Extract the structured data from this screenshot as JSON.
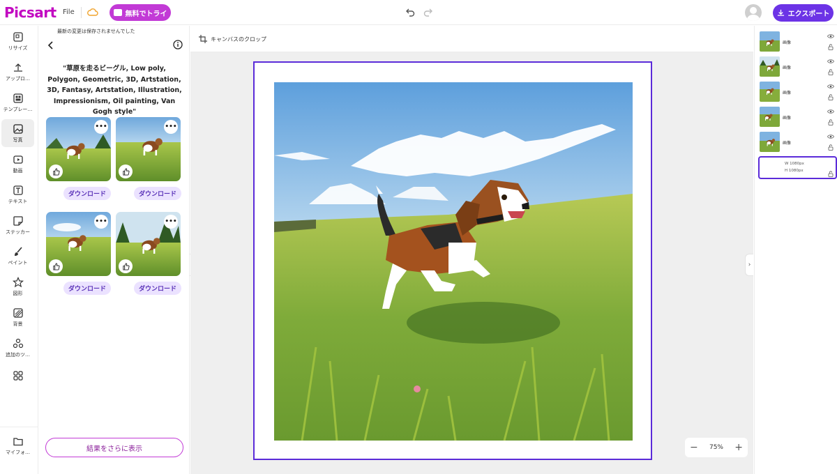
{
  "topbar": {
    "logo": "Picsart",
    "file_label": "File",
    "try_label": "無料でトライ",
    "export_label": "エクスポート"
  },
  "rail": {
    "items": [
      {
        "label": "リサイズ",
        "icon": "resize-icon"
      },
      {
        "label": "アップロ…",
        "icon": "upload-icon"
      },
      {
        "label": "テンプレー…",
        "icon": "templates-icon"
      },
      {
        "label": "写真",
        "icon": "photo-icon"
      },
      {
        "label": "動画",
        "icon": "video-icon"
      },
      {
        "label": "テキスト",
        "icon": "text-icon"
      },
      {
        "label": "ステッカー",
        "icon": "sticker-icon"
      },
      {
        "label": "ペイント",
        "icon": "paint-icon"
      },
      {
        "label": "図形",
        "icon": "shape-icon"
      },
      {
        "label": "背景",
        "icon": "background-icon"
      },
      {
        "label": "追加のツ…",
        "icon": "tools-icon"
      },
      {
        "label": "",
        "icon": "apps-icon"
      },
      {
        "label": "マイフォ…",
        "icon": "folder-icon"
      }
    ]
  },
  "panel": {
    "unsaved_notice": "最新の変更は保存されませんでした",
    "prompt": "\"草原を走るビーグル, Low poly, Polygon, Geometric, 3D, Artstation, 3D, Fantasy, Artstation, Illustration, Impressionism, Oil painting, Van Gogh style\"",
    "download_label": "ダウンロード",
    "more_results_label": "結果をさらに表示"
  },
  "canvas": {
    "crop_label": "キャンバスのクロップ",
    "zoom": "75%",
    "zoom_minus": "−",
    "zoom_plus": "+"
  },
  "layers": {
    "items": [
      {
        "name": "画像"
      },
      {
        "name": "画像"
      },
      {
        "name": "画像"
      },
      {
        "name": "画像"
      },
      {
        "name": "画像"
      }
    ],
    "background": {
      "width": "W 1080px",
      "height": "H 1080px"
    }
  },
  "colors": {
    "brand": "#c209c1",
    "accent": "#5b2bd9",
    "export": "#6c33e6"
  }
}
